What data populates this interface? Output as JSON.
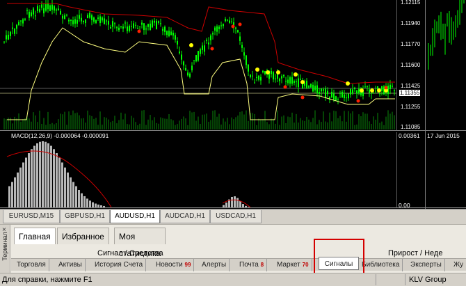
{
  "chart": {
    "price_labels": [
      "1.12115",
      "1.11940",
      "1.11770",
      "1.11600",
      "1.11425",
      "1.11355",
      "1.11255",
      "1.11085"
    ],
    "macd_label": "MACD(12,26,9) -0.000064 -0.000091",
    "macd_top": "0.00361",
    "macd_bottom": "0.00",
    "date_label": "17 Jun 2015",
    "colors": {
      "bull": "#00ff00",
      "bear": "#00ff00",
      "signal_line": "#cc0000",
      "envelope": "#ffff80",
      "dot_yellow": "#ffff00",
      "dot_red": "#ff2000"
    }
  },
  "symbol_tabs": [
    "EURUSD,M15",
    "GBPUSD,H1",
    "AUDUSD,H1",
    "AUDCAD,H1",
    "USDCAD,H1"
  ],
  "symbol_tabs_active": "AUDUSD,H1",
  "terminal": {
    "side_label": "Терминал",
    "close_glyph": "×",
    "main_tabs": [
      "Главная",
      "Избранное",
      "Моя статистика"
    ],
    "main_tab_active": "Главная",
    "signals_header": "Сигнал / Средства",
    "growth_header": "Прирост / Неде",
    "bottom_tabs": [
      {
        "label": "Торговля",
        "badge": ""
      },
      {
        "label": "Активы",
        "badge": ""
      },
      {
        "label": "История Счета",
        "badge": ""
      },
      {
        "label": "Новости",
        "badge": "99"
      },
      {
        "label": "Алерты",
        "badge": ""
      },
      {
        "label": "Почта",
        "badge": "8"
      },
      {
        "label": "Маркет",
        "badge": "70"
      },
      {
        "label": "Сигналы",
        "badge": ""
      },
      {
        "label": "Библиотека",
        "badge": ""
      },
      {
        "label": "Эксперты",
        "badge": ""
      },
      {
        "label": "Жу",
        "badge": ""
      }
    ],
    "bottom_tab_active": "Сигналы"
  },
  "status": {
    "help_text": "Для справки, нажмите F1",
    "profile": "KLV Group"
  }
}
